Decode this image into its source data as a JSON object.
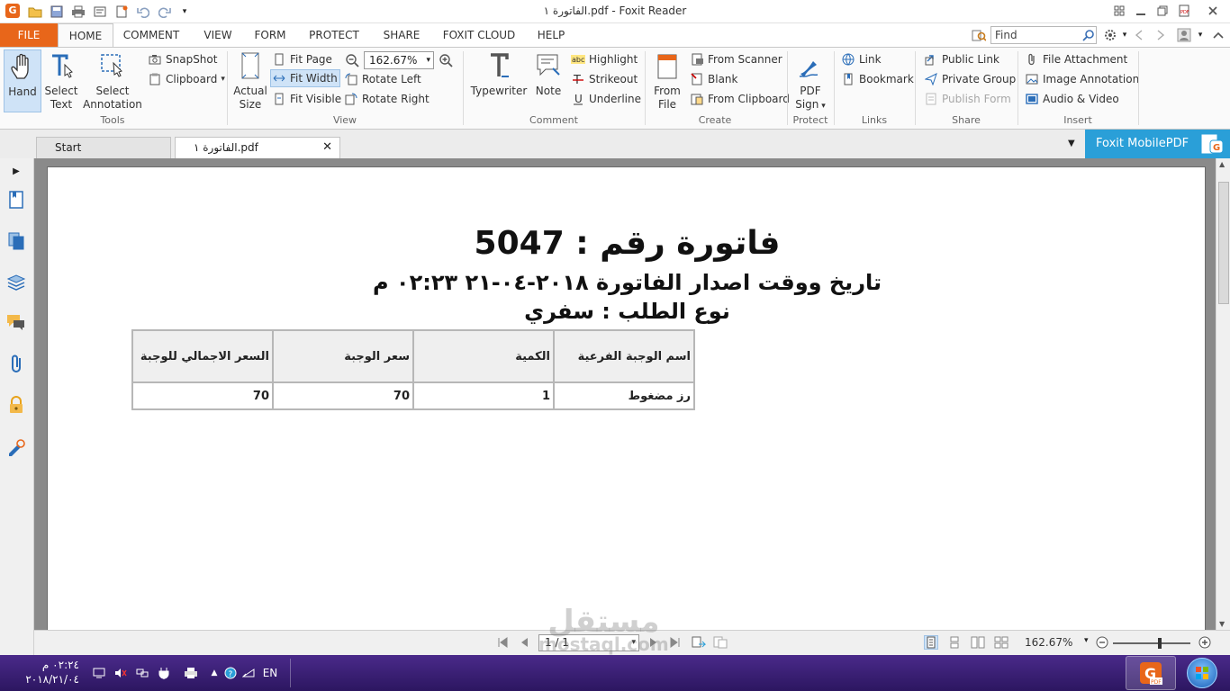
{
  "window": {
    "title": "الفاتورة ١.pdf - Foxit Reader"
  },
  "menu_tabs": {
    "file": "FILE",
    "items": [
      "HOME",
      "COMMENT",
      "VIEW",
      "FORM",
      "PROTECT",
      "SHARE",
      "FOXIT CLOUD",
      "HELP"
    ],
    "active": "HOME"
  },
  "find": {
    "placeholder": "Find"
  },
  "ribbon": {
    "tools": {
      "label": "Tools",
      "hand": "Hand",
      "select_text_1": "Select",
      "select_text_2": "Text",
      "select_annot_1": "Select",
      "select_annot_2": "Annotation",
      "snapshot": "SnapShot",
      "clipboard": "Clipboard"
    },
    "view": {
      "label": "View",
      "actual_1": "Actual",
      "actual_2": "Size",
      "fit_page": "Fit Page",
      "fit_width": "Fit Width",
      "fit_visible": "Fit Visible",
      "zoom": "162.67%",
      "rotate_left": "Rotate Left",
      "rotate_right": "Rotate Right"
    },
    "comment": {
      "label": "Comment",
      "typewriter": "Typewriter",
      "note": "Note",
      "highlight": "Highlight",
      "strikeout": "Strikeout",
      "underline": "Underline"
    },
    "create": {
      "label": "Create",
      "from_file_1": "From",
      "from_file_2": "File",
      "from_scanner": "From Scanner",
      "blank": "Blank",
      "from_clipboard": "From Clipboard"
    },
    "protect": {
      "label": "Protect",
      "pdf_sign_1": "PDF",
      "pdf_sign_2": "Sign"
    },
    "links": {
      "label": "Links",
      "link": "Link",
      "bookmark": "Bookmark"
    },
    "share": {
      "label": "Share",
      "public_link": "Public Link",
      "private_group": "Private Group",
      "publish_form": "Publish Form"
    },
    "insert": {
      "label": "Insert",
      "file_attachment": "File Attachment",
      "image_annotation": "Image Annotation",
      "audio_video": "Audio & Video"
    }
  },
  "doc_tabs": {
    "start": "Start",
    "current": "الفاتورة ١.pdf",
    "mobile": "Foxit MobilePDF"
  },
  "document": {
    "title": "فاتورة رقم :  5047",
    "issue_line": "تاريخ ووقت اصدار الفاتورة ٢٠١٨-٠٤-٢١  ٠٢:٢٣ م",
    "order_type": "نوع الطلب   : سفري",
    "table": {
      "headers": [
        "اسم الوجبة الفرعية",
        "الكمية",
        "سعر الوجبة",
        "السعر الاجمالي للوجبة"
      ],
      "rows": [
        [
          "رز مضغوط",
          "1",
          "70",
          "70"
        ]
      ]
    }
  },
  "status": {
    "page": "1 / 1",
    "zoom": "162.67%"
  },
  "watermark": {
    "ar": "مستقل",
    "en": "mostaql.com"
  },
  "taskbar": {
    "time": "٠٢:٢٤ م",
    "date": "٢٠١٨/٢١/٠٤",
    "lang": "EN"
  },
  "colors": {
    "accent": "#e8661a",
    "mobile": "#2a9fd8",
    "taskbar": "#3a1f75"
  }
}
